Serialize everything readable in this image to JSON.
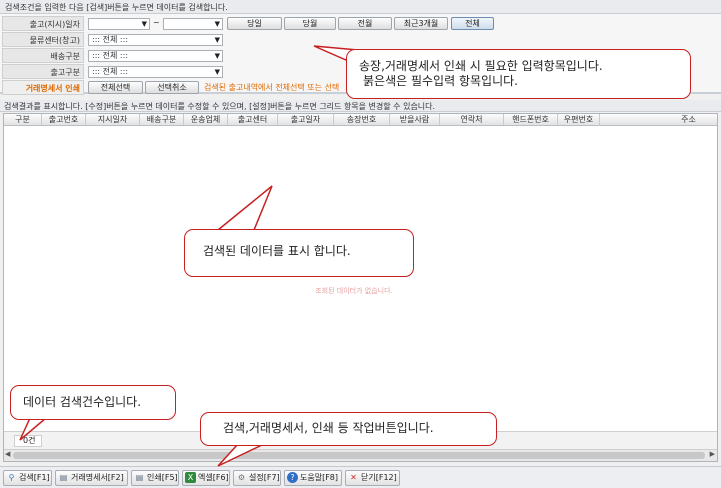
{
  "topbar": {
    "text": "검색조건을 입력한 다음 [검색]버튼을 누르면 데이터를 검색합니다."
  },
  "search": {
    "labels": {
      "date": "출고(지시)일자",
      "center": "물류센터(창고)",
      "ship": "배송구분",
      "outtype": "출고구분",
      "print": "거래명세서 인쇄"
    },
    "range_sep": "~",
    "center_value": "::: 전체 :::",
    "ship_value": "::: 전체 :::",
    "outtype_value": "::: 전체 :::",
    "date_buttons": [
      "당일",
      "당월",
      "전월",
      "최근3개월",
      "전체"
    ],
    "select_all": "전체선택",
    "deselect": "선택취소",
    "print_hint": "검색된 출고내역에서 전체선택 또는 선택"
  },
  "result": {
    "bar_text": "검색결과를 표시합니다. [수정]버튼을 누르면 데이터를 수정할 수 있으며, [설정]버튼을 누르면 그리드 항목을 변경할 수 있습니다.",
    "columns": [
      "구분",
      "출고번호",
      "지시일자",
      "배송구분",
      "운송업체",
      "출고센터",
      "출고일자",
      "송장번호",
      "받을사람",
      "연락처",
      "핸드폰번호",
      "우편번호",
      "주소"
    ],
    "no_rows": "조회된 데이터가 없습니다.",
    "count": "0건"
  },
  "toolbar": {
    "buttons": [
      {
        "label": "검색[F1]",
        "icon": "search-icon",
        "color": "#3a78c2"
      },
      {
        "label": "거래명세서[F2]",
        "icon": "printer-icon",
        "color": "#5a6b80"
      },
      {
        "label": "인쇄[F5]",
        "icon": "printer-icon",
        "color": "#5a6b80"
      },
      {
        "label": "엑셀[F6]",
        "icon": "excel-icon",
        "color": "#2f8a3e"
      },
      {
        "label": "설정[F7]",
        "icon": "gear-icon",
        "color": "#777777"
      },
      {
        "label": "도움말[F8]",
        "icon": "help-icon",
        "color": "#2f6fc8"
      },
      {
        "label": "닫기[F12]",
        "icon": "close-icon",
        "color": "#d02a2a"
      }
    ]
  },
  "callouts": {
    "c1_line1": "송장,거래명세서 인쇄 시 필요한 입력항목입니다.",
    "c1_line2": "붉은색은 필수입력 항목입니다.",
    "c2": "검색된 데이터를 표시 합니다.",
    "c3": "데이터 검색건수입니다.",
    "c4": "검색,거래명세서, 인쇄  등 작업버튼입니다."
  },
  "colors": {
    "required": "#e06a00",
    "callout_border": "#c82020"
  }
}
